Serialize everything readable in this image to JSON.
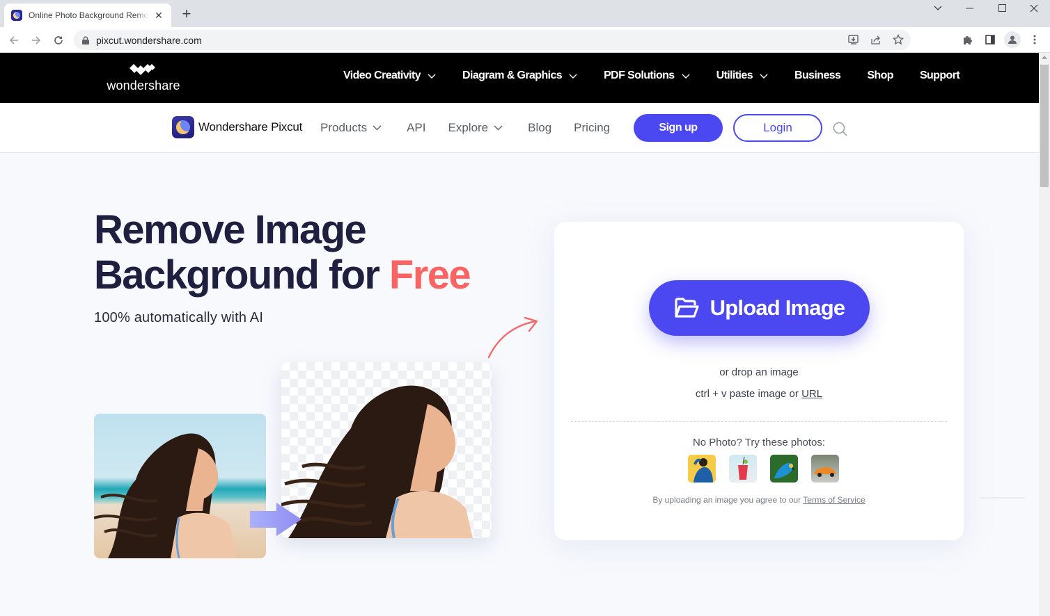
{
  "browser": {
    "tab": {
      "title": "Online Photo Background Remover",
      "favicon": "pixcut-favicon",
      "close_icon": "close-icon"
    },
    "new_tab_icon": "plus-icon",
    "window_controls": [
      "chevron-down-icon",
      "minimize-icon",
      "maximize-icon",
      "close-icon"
    ],
    "url": "pixcut.wondershare.com",
    "lock_icon": "lock-icon",
    "toolbar_icons": [
      "install-icon",
      "share-icon",
      "star-icon",
      "extensions-icon",
      "side-panel-icon",
      "profile-icon",
      "more-icon"
    ]
  },
  "wondershare_nav": {
    "logo_text": "wondershare",
    "items": [
      {
        "label": "Video Creativity",
        "dropdown": true
      },
      {
        "label": "Diagram & Graphics",
        "dropdown": true
      },
      {
        "label": "PDF Solutions",
        "dropdown": true
      },
      {
        "label": "Utilities",
        "dropdown": true
      },
      {
        "label": "Business",
        "dropdown": false
      },
      {
        "label": "Shop",
        "dropdown": false
      },
      {
        "label": "Support",
        "dropdown": false
      }
    ]
  },
  "pixcut_nav": {
    "brand": "Wondershare Pixcut",
    "links": [
      {
        "label": "Products",
        "dropdown": true
      },
      {
        "label": "API",
        "dropdown": false
      },
      {
        "label": "Explore",
        "dropdown": true
      },
      {
        "label": "Blog",
        "dropdown": false
      },
      {
        "label": "Pricing",
        "dropdown": false
      }
    ],
    "signup_label": "Sign up",
    "login_label": "Login",
    "search_icon": "search-icon"
  },
  "hero": {
    "title_line1": "Remove Image",
    "title_line2_prefix": "Background for ",
    "title_accent": "Free",
    "subtitle": "100% automatically with AI"
  },
  "upload": {
    "button_label": "Upload Image",
    "button_icon": "folder-open-icon",
    "drop_text": "or drop an image",
    "paste_prefix": "ctrl + v paste image or ",
    "paste_link": "URL",
    "try_label": "No Photo? Try these photos:",
    "samples": [
      "sample-person",
      "sample-drink",
      "sample-parrot",
      "sample-car"
    ],
    "terms_prefix": "By uploading an image you agree to our ",
    "terms_link": "Terms of Service"
  },
  "colors": {
    "brand": "#4b48f2",
    "accent": "#fb6462",
    "heading": "#1f1f3f",
    "page_bg": "#f7f9fd"
  }
}
